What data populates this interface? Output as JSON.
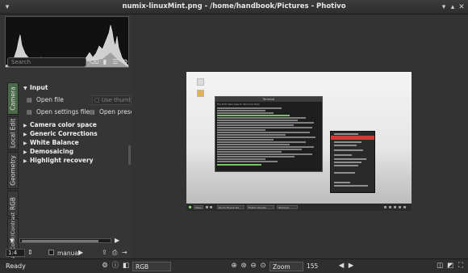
{
  "window": {
    "title": "numix-linuxMint.png - /home/handbook/Pictures - Photivo"
  },
  "left_panel": {
    "search_placeholder": "Search",
    "tabs": [
      "Camera",
      "Local Edit",
      "Geometry",
      "RGB",
      "Lab Color/Contrast"
    ],
    "active_tab": "Camera",
    "input_section": {
      "title": "Input",
      "open_file": "Open file",
      "use_thumbnail": "Use thumb",
      "open_settings_file": "Open settings file",
      "open_preset": "Open prese"
    },
    "sections": [
      "Camera color space",
      "Generic Corrections",
      "White Balance",
      "Demosaicing",
      "Highlight recovery"
    ],
    "zoom_value": "1:4",
    "manual_label": "manual"
  },
  "screenshot": {
    "terminal_title": "Terminal",
    "terminal_menu": "File  Edit  View  Search  Terminal  Help",
    "taskbar_items": [
      "Menu",
      "Zoom Thunar 6a",
      "Firefox Ubuntu",
      "Terminal"
    ]
  },
  "status_bar": {
    "status": "Ready",
    "channel": "RGB",
    "zoom_mode": "Zoom",
    "zoom_value": "155"
  },
  "colors": {
    "accent_active_tab": "#4a6a4a",
    "context_highlight": "#d23a3a",
    "terminal_green": "#7fd36a"
  }
}
